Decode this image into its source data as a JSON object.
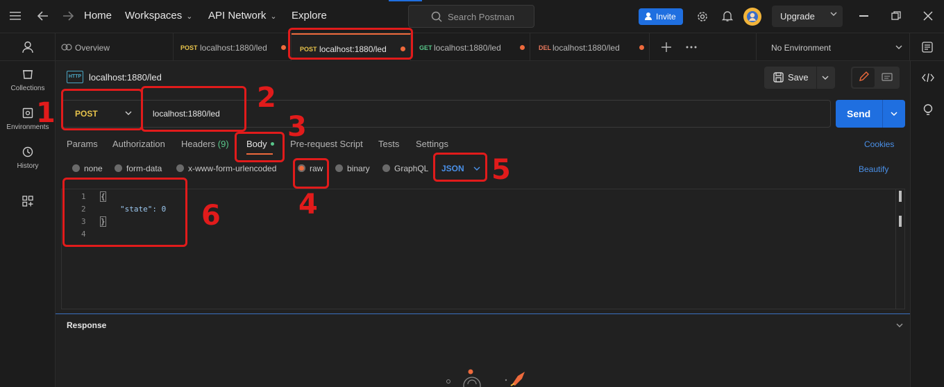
{
  "topbar": {
    "nav": [
      "Home",
      "Workspaces",
      "API Network",
      "Explore"
    ],
    "search_placeholder": "Search Postman",
    "invite_label": "Invite",
    "upgrade_label": "Upgrade"
  },
  "sidebar": {
    "items": [
      {
        "label": "Collections",
        "icon": "collections-icon"
      },
      {
        "label": "Environments",
        "icon": "environments-icon"
      },
      {
        "label": "History",
        "icon": "history-icon"
      }
    ]
  },
  "tabs": [
    {
      "label": "Overview"
    },
    {
      "method": "POST",
      "url": "localhost:1880/led"
    },
    {
      "method": "POST",
      "url": "localhost:1880/led"
    },
    {
      "method": "GET",
      "url": "localhost:1880/led"
    },
    {
      "method": "DEL",
      "url": "localhost:1880/led"
    }
  ],
  "environment": "No Environment",
  "request": {
    "title": "localhost:1880/led",
    "method": "POST",
    "url": "localhost:1880/led",
    "save_label": "Save",
    "send_label": "Send",
    "subtabs": [
      "Params",
      "Authorization",
      "Headers",
      "(9)",
      "Body",
      "Pre-request Script",
      "Tests",
      "Settings"
    ],
    "cookies_label": "Cookies",
    "body_modes": [
      "none",
      "form-data",
      "x-www-form-urlencoded",
      "raw",
      "binary",
      "GraphQL"
    ],
    "body_format": "JSON",
    "beautify_label": "Beautify",
    "code_lines": [
      "{",
      "\"state\": 0",
      "}",
      ""
    ],
    "line_numbers": [
      "1",
      "2",
      "3",
      "4"
    ]
  },
  "response": {
    "title": "Response"
  },
  "annotations": [
    "1",
    "2",
    "3",
    "4",
    "5",
    "6"
  ],
  "colors": {
    "accent": "#1f6fe0",
    "post": "#e7c34b",
    "get": "#58c78a",
    "del": "#e8785c",
    "annotation": "#e11b1b"
  }
}
